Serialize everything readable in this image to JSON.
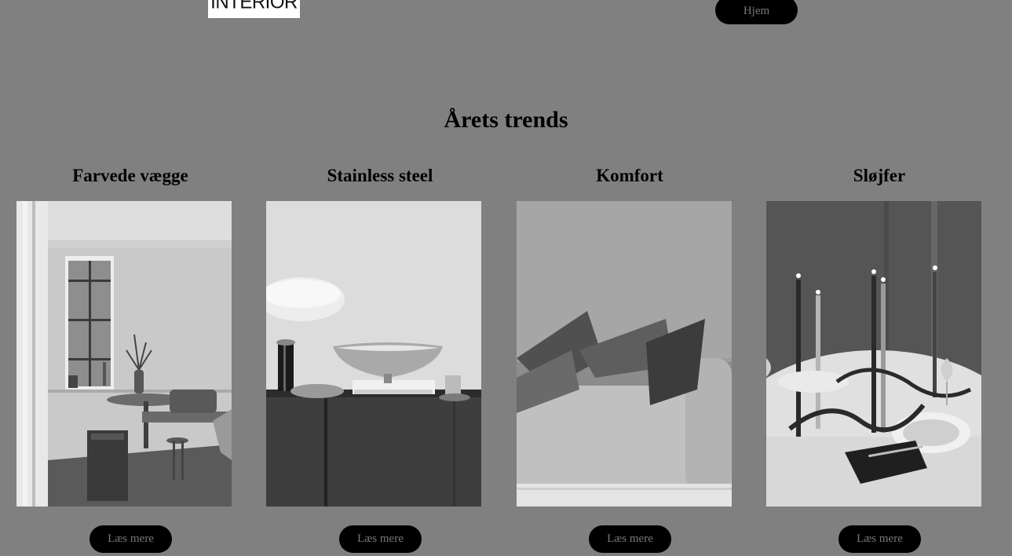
{
  "header": {
    "logo_text": "INTERIOR",
    "logo_sub": "· · · ·",
    "nav_button": "Hjem"
  },
  "section": {
    "title": "Årets trends"
  },
  "cards": [
    {
      "title": "Farvede vægge",
      "button": "Læs mere",
      "image": "grey-room-with-window-and-table"
    },
    {
      "title": "Stainless steel",
      "button": "Læs mere",
      "image": "steel-bowl-and-lamp-on-sideboard"
    },
    {
      "title": "Komfort",
      "button": "Læs mere",
      "image": "boucle-sofa-with-cushions"
    },
    {
      "title": "Sløjfer",
      "button": "Læs mere",
      "image": "dinner-table-with-candles-and-ribbons"
    }
  ],
  "colors": {
    "background": "#808080",
    "button_bg": "#000000",
    "button_text": "#777777"
  }
}
